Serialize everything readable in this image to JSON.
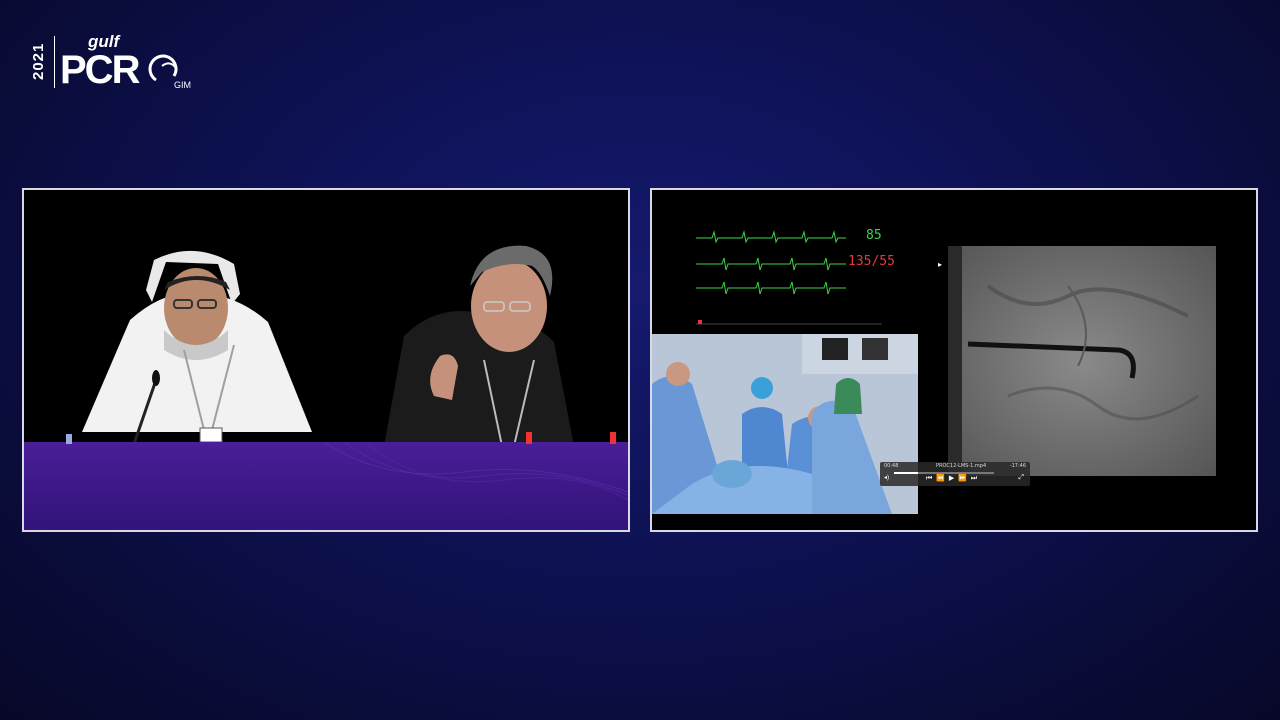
{
  "logo": {
    "year": "2021",
    "gulf": "gulf",
    "pcr": "PCR",
    "gim": "GIM"
  },
  "monitor": {
    "heart_rate": "85",
    "blood_pressure": "135/55"
  },
  "player": {
    "time_elapsed": "00:48",
    "file_name": "PROC12-LMS-1.mp4",
    "time_remaining": "-17:46",
    "controls": "⏮ ⏪ ▶ ⏩ ⏭",
    "progress": 0.24
  },
  "colors": {
    "background": "#0e1256",
    "desk": "#3b1785",
    "ecg": "#3ed34a",
    "bp": "#e23a3a"
  }
}
